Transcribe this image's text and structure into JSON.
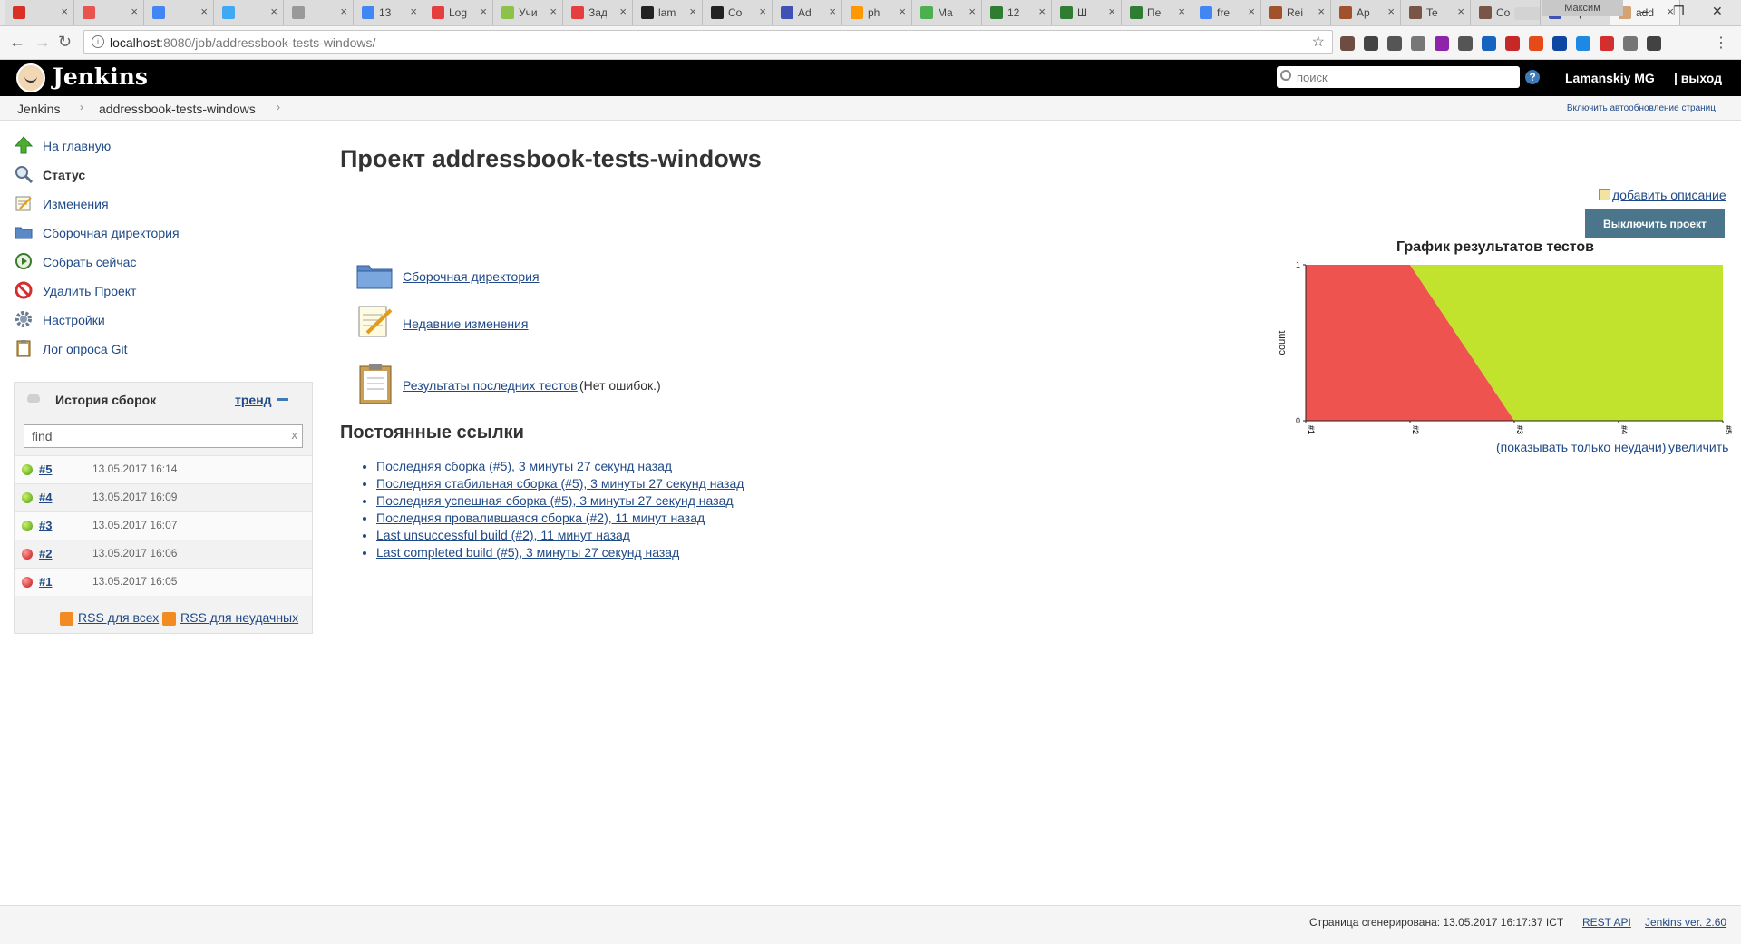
{
  "browser": {
    "tabs": [
      {
        "label": "",
        "color": "#d93025"
      },
      {
        "label": "",
        "color": "#e8554e"
      },
      {
        "label": "",
        "color": "#4285f4"
      },
      {
        "label": "",
        "color": "#3fa9f5"
      },
      {
        "label": "",
        "color": "#999999"
      },
      {
        "label": "13",
        "color": "#4285f4"
      },
      {
        "label": "Log",
        "color": "#e53e3e"
      },
      {
        "label": "Учи",
        "color": "#8bc34a"
      },
      {
        "label": "Зад",
        "color": "#e53e3e"
      },
      {
        "label": "lam",
        "color": "#222222"
      },
      {
        "label": "Co",
        "color": "#222222"
      },
      {
        "label": "Ad",
        "color": "#3f51b5"
      },
      {
        "label": "ph",
        "color": "#ff9800"
      },
      {
        "label": "Ma",
        "color": "#4caf50"
      },
      {
        "label": "12",
        "color": "#2e7d32"
      },
      {
        "label": "Ш",
        "color": "#2e7d32"
      },
      {
        "label": "Пе",
        "color": "#2e7d32"
      },
      {
        "label": "fre",
        "color": "#4285f4"
      },
      {
        "label": "Rei",
        "color": "#a0522d"
      },
      {
        "label": "Ap",
        "color": "#a0522d"
      },
      {
        "label": "Te",
        "color": "#795548"
      },
      {
        "label": "Co",
        "color": "#795548"
      },
      {
        "label": "Стр",
        "color": "#3f51b5"
      },
      {
        "label": "add",
        "color": "#d4a373"
      }
    ],
    "profile_name": "Максим",
    "url_host": "localhost",
    "url_rest": ":8080/job/addressbook-tests-windows/",
    "ext_colors": [
      "#6d4c41",
      "#444444",
      "#555555",
      "#777777",
      "#8e24aa",
      "#555555",
      "#1565c0",
      "#c62828",
      "#e64a19",
      "#0d47a1",
      "#1e88e5",
      "#d32f2f",
      "#757575",
      "#424242"
    ]
  },
  "header": {
    "title": "Jenkins",
    "search_placeholder": "поиск",
    "help": "?",
    "user": "Lamanskiy MG",
    "logout": "| выход"
  },
  "breadcrumb": {
    "items": [
      "Jenkins",
      "addressbook-tests-windows"
    ],
    "autorefresh": "Включить автообновление страниц"
  },
  "sidebar": {
    "tasks": [
      {
        "label": "На главную",
        "icon": "up-arrow-icon",
        "bold": false
      },
      {
        "label": "Статус",
        "icon": "magnifier-icon",
        "bold": true
      },
      {
        "label": "Изменения",
        "icon": "notepad-icon",
        "bold": false
      },
      {
        "label": "Сборочная директория",
        "icon": "folder-icon",
        "bold": false
      },
      {
        "label": "Собрать сейчас",
        "icon": "build-clock-icon",
        "bold": false
      },
      {
        "label": "Удалить Проект",
        "icon": "no-entry-icon",
        "bold": false
      },
      {
        "label": "Настройки",
        "icon": "gear-icon",
        "bold": false
      },
      {
        "label": "Лог опроса Git",
        "icon": "clipboard-icon",
        "bold": false
      }
    ],
    "build_history": {
      "title": "История сборок",
      "trend": "тренд",
      "filter_value": "find",
      "clear": "x",
      "builds": [
        {
          "num": "#5",
          "date": "13.05.2017 16:14",
          "status": "success"
        },
        {
          "num": "#4",
          "date": "13.05.2017 16:09",
          "status": "success"
        },
        {
          "num": "#3",
          "date": "13.05.2017 16:07",
          "status": "success"
        },
        {
          "num": "#2",
          "date": "13.05.2017 16:06",
          "status": "failed"
        },
        {
          "num": "#1",
          "date": "13.05.2017 16:05",
          "status": "failed"
        }
      ],
      "rss_all": "RSS для всех",
      "rss_failed": "RSS для неудачных"
    }
  },
  "main": {
    "title": "Проект addressbook-tests-windows",
    "add_description": "добавить описание",
    "disable_button": "Выключить проект",
    "workspace_link": "Сборочная директория",
    "recent_changes_link": "Недавние изменения",
    "test_results_link": "Результаты последних тестов",
    "test_results_note": "(Нет ошибок.)",
    "permalinks_title": "Постоянные ссылки",
    "permalinks": [
      "Последняя сборка (#5), 3 минуты 27 секунд назад",
      "Последняя стабильная сборка (#5), 3 минуты 27 секунд назад",
      "Последняя успешная сборка (#5), 3 минуты 27 секунд назад",
      "Последняя провалившаяся сборка (#2), 11 минут назад",
      "Last unsuccessful build (#2), 11 минут назад",
      "Last completed build (#5), 3 минуты 27 секунд назад"
    ]
  },
  "chart_data": {
    "type": "area",
    "title": "График результатов тестов",
    "ylabel": "count",
    "xlabel": "",
    "categories": [
      "#1",
      "#2",
      "#3",
      "#4",
      "#5"
    ],
    "ylim": [
      0,
      1
    ],
    "yticks": [
      "0",
      "1"
    ],
    "series": [
      {
        "name": "",
        "color": "#ef5350",
        "values": [
          1,
          1,
          0,
          0,
          0
        ]
      },
      {
        "name": "",
        "color": "#c2e32e",
        "values": [
          0,
          0,
          1,
          1,
          1
        ]
      }
    ],
    "show_failures_link": "(показывать только неудачи)",
    "enlarge_link": "увеличить"
  },
  "footer": {
    "generated": "Страница сгенерирована: 13.05.2017 16:17:37 ICT",
    "rest_api": "REST API",
    "version": "Jenkins ver. 2.60"
  }
}
